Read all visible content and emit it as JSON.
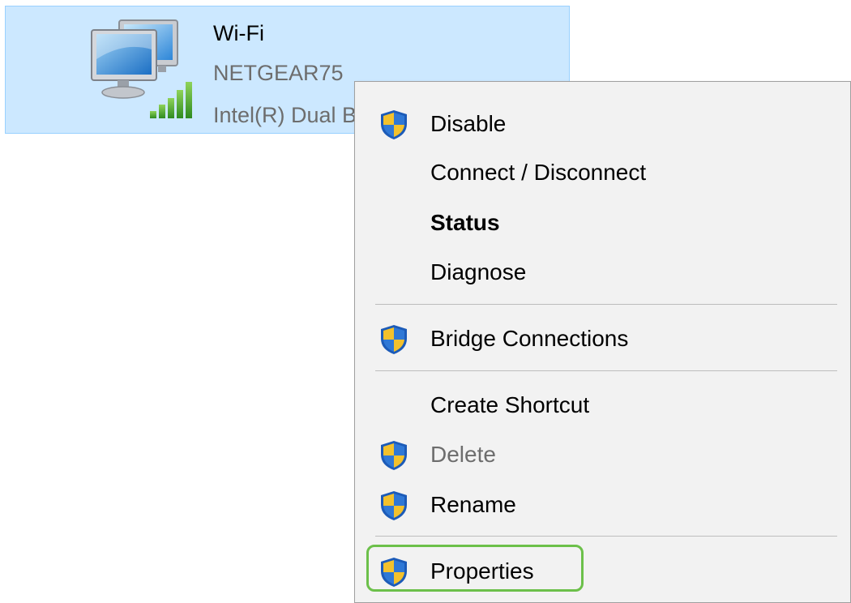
{
  "adapter": {
    "name": "Wi-Fi",
    "network": "NETGEAR75",
    "device": "Intel(R) Dual Band Wireless-AC",
    "icon": "network-adapter-wifi-icon",
    "colors": {
      "tile_bg": "#cce8ff",
      "tile_border": "#99d1ff"
    }
  },
  "context_menu": {
    "items": [
      {
        "label": "Disable",
        "shield": true,
        "bold": false,
        "disabled": false
      },
      {
        "label": "Connect / Disconnect",
        "shield": false,
        "bold": false,
        "disabled": false
      },
      {
        "label": "Status",
        "shield": false,
        "bold": true,
        "disabled": false
      },
      {
        "label": "Diagnose",
        "shield": false,
        "bold": false,
        "disabled": false
      },
      {
        "label": "Bridge Connections",
        "shield": true,
        "bold": false,
        "disabled": false
      },
      {
        "label": "Create Shortcut",
        "shield": false,
        "bold": false,
        "disabled": false
      },
      {
        "label": "Delete",
        "shield": true,
        "bold": false,
        "disabled": true
      },
      {
        "label": "Rename",
        "shield": true,
        "bold": false,
        "disabled": false
      },
      {
        "label": "Properties",
        "shield": true,
        "bold": false,
        "disabled": false
      }
    ],
    "highlighted_item": "Properties",
    "colors": {
      "highlight": "#6cc04a",
      "disabled_text": "#6d6d6d"
    }
  }
}
